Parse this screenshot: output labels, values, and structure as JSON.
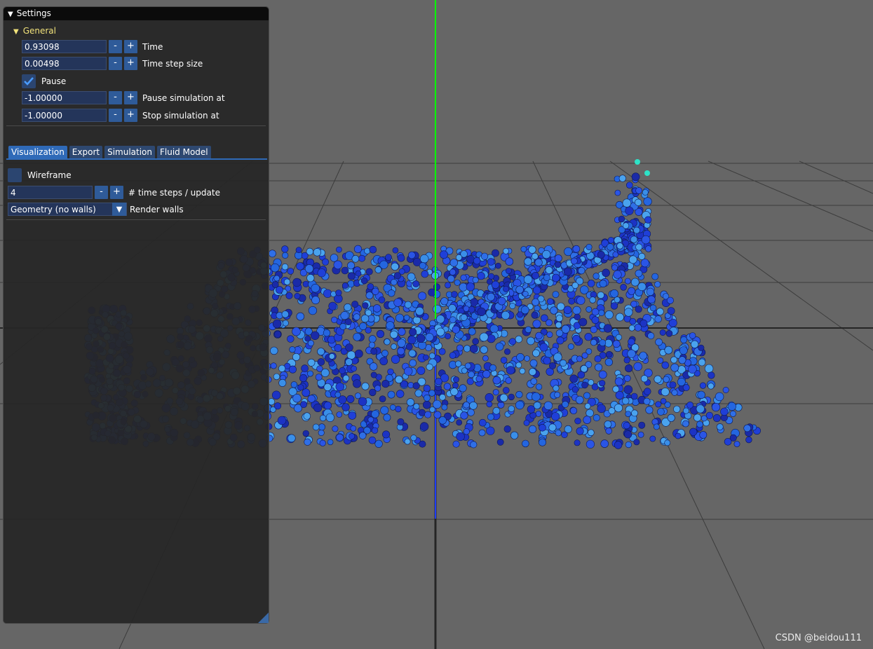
{
  "window": {
    "title": "Settings"
  },
  "general": {
    "header": "General",
    "time": {
      "value": "0.93098",
      "label": "Time"
    },
    "step": {
      "value": "0.00498",
      "label": "Time step size"
    },
    "pause": {
      "label": "Pause",
      "checked": true
    },
    "pause_at": {
      "value": "-1.00000",
      "label": "Pause simulation at"
    },
    "stop_at": {
      "value": "-1.00000",
      "label": "Stop simulation at"
    },
    "minus": "-",
    "plus": "+"
  },
  "tabs": [
    {
      "label": "Visualization",
      "active": true
    },
    {
      "label": "Export",
      "active": false
    },
    {
      "label": "Simulation",
      "active": false
    },
    {
      "label": "Fluid Model",
      "active": false
    }
  ],
  "visualization": {
    "wireframe": {
      "label": "Wireframe",
      "checked": false
    },
    "steps": {
      "value": "4",
      "label": "# time steps / update"
    },
    "walls": {
      "value": "Geometry (no walls)",
      "label": "Render walls"
    }
  },
  "watermark": "CSDN @beidou111",
  "colors": {
    "accent": "#2f6ab8",
    "header_text": "#f1e27a",
    "y_axis": "#00ff00",
    "z_axis": "#1e3cff",
    "background": "#666666"
  }
}
